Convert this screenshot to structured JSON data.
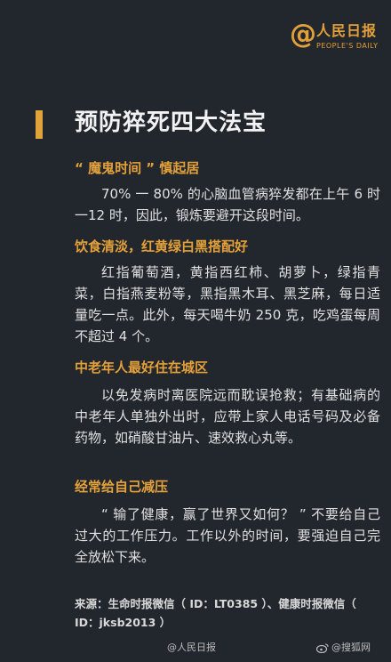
{
  "brand": {
    "at_symbol": "@",
    "name_cn": "人民日报",
    "name_en": "PEOPLE'S DAILY"
  },
  "title": "预防猝死四大法宝",
  "sections": [
    {
      "heading": "“ 魔鬼时间 ” 慎起居",
      "body": "70% 一 80% 的心脑血管病猝发都在上午 6 时一12 时，因此，锻炼要避开这段时间。"
    },
    {
      "heading": "饮食清淡，红黄绿白黑搭配好",
      "body": "红指葡萄酒，黄指西红柿、胡萝卜，绿指青菜，白指燕麦粉等，黑指黑木耳、黑芝麻，每日适量吃一点。此外，每天喝牛奶 250 克，吃鸡蛋每周不超过 4 个。"
    },
    {
      "heading": "中老年人最好住在城区",
      "body": "以免发病时离医院远而耽误抢救；有基础病的中老年人单独外出时，应带上家人电话号码及必备药物，如硝酸甘油片、速效救心丸等。"
    },
    {
      "heading": "经常给自己减压",
      "body": "“ 输了健康，赢了世界又如何？ ” 不要给自己过大的工作压力。工作以外的时间，要强迫自己完全放松下来。"
    }
  ],
  "source": "来源：生命时报微信（ ID：LT0385 ）、健康时报微信（ ID：jksb2013 ）",
  "footer": {
    "watermark": "@人民日报",
    "site": "@搜狐网"
  },
  "colors": {
    "background": "#22262d",
    "accent": "#e4a13a",
    "text": "#e0e0e0"
  }
}
